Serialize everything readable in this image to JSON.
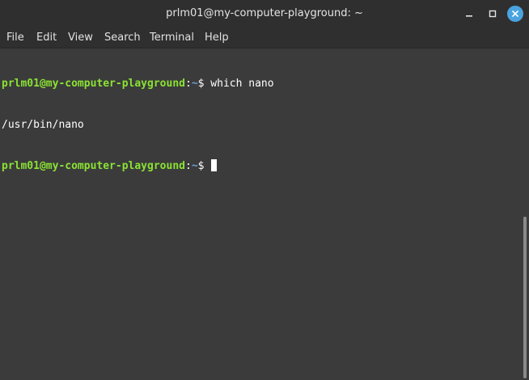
{
  "window": {
    "title": "prlm01@my-computer-playground: ~",
    "controls": {
      "minimize_icon": "minimize-icon",
      "maximize_icon": "maximize-icon",
      "close_icon": "close-icon",
      "close_color": "#4aa3e0"
    }
  },
  "menu": {
    "file": "File",
    "edit": "Edit",
    "view": "View",
    "search": "Search",
    "terminal": "Terminal",
    "help": "Help"
  },
  "terminal": {
    "colors": {
      "background": "#3b3b3b",
      "user_host": "#8ae234",
      "path": "#729fcf",
      "text": "#ffffff"
    },
    "line1": {
      "user_host": "prlm01@my-computer-playground",
      "colon": ":",
      "path": "~",
      "prompt_symbol": "$ ",
      "command": "which nano"
    },
    "line2": {
      "output": "/usr/bin/nano"
    },
    "line3": {
      "user_host": "prlm01@my-computer-playground",
      "colon": ":",
      "path": "~",
      "prompt_symbol": "$ "
    }
  }
}
